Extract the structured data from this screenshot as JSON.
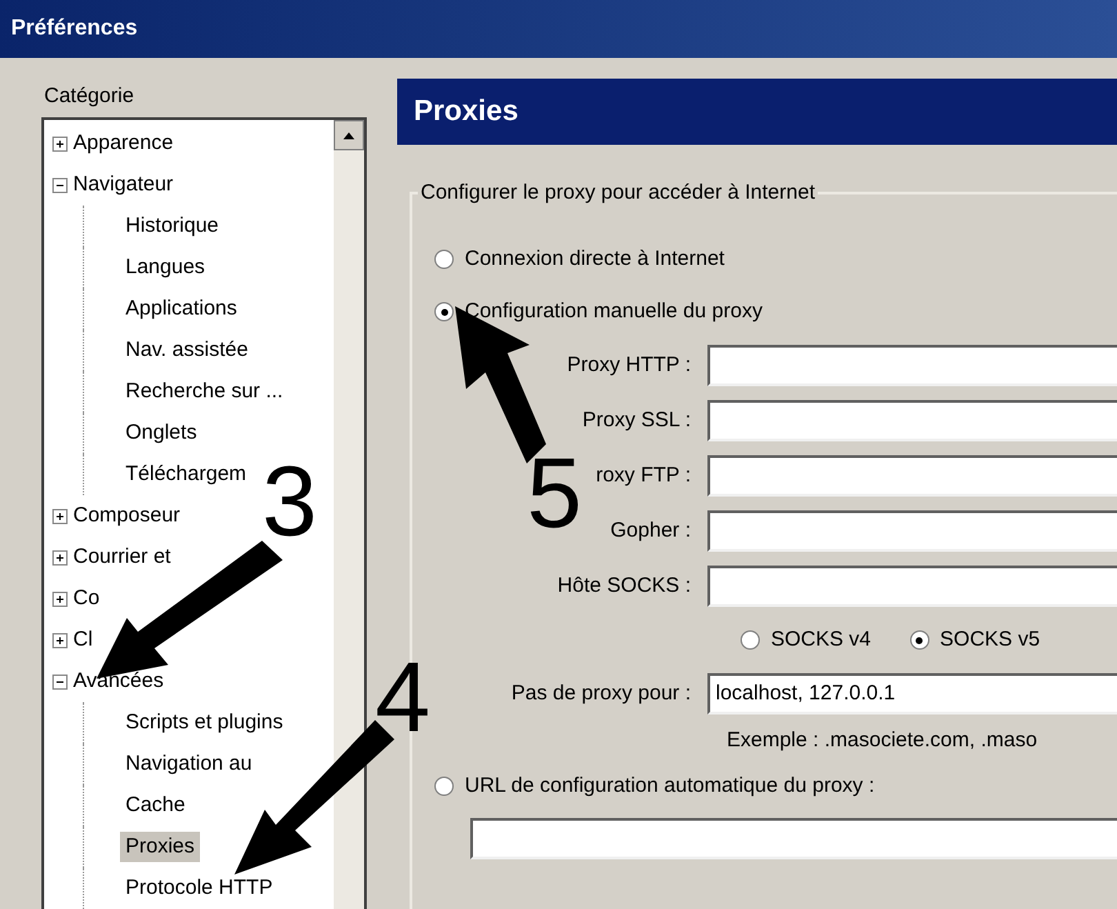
{
  "window": {
    "title": "Préférences"
  },
  "sidebar": {
    "label": "Catégorie",
    "items": [
      {
        "label": "Apparence",
        "expanded": false,
        "selected": false
      },
      {
        "label": "Navigateur",
        "expanded": true,
        "selected": false,
        "children": [
          {
            "label": "Historique",
            "selected": false
          },
          {
            "label": "Langues",
            "selected": false
          },
          {
            "label": "Applications",
            "selected": false
          },
          {
            "label": "Nav. assistée",
            "selected": false
          },
          {
            "label": "Recherche sur ...",
            "selected": false
          },
          {
            "label": "Onglets",
            "selected": false
          },
          {
            "label": "Téléchargem",
            "selected": false
          }
        ]
      },
      {
        "label": "Composeur",
        "expanded": false,
        "selected": false
      },
      {
        "label": "Courrier et",
        "expanded": false,
        "selected": false
      },
      {
        "label": "Co",
        "expanded": false,
        "selected": false
      },
      {
        "label": "Cl",
        "expanded": false,
        "selected": false
      },
      {
        "label": "Avancées",
        "expanded": true,
        "selected": false,
        "children": [
          {
            "label": "Scripts et plugins",
            "selected": false
          },
          {
            "label": "Navigation au",
            "selected": false
          },
          {
            "label": "Cache",
            "selected": false
          },
          {
            "label": "Proxies",
            "selected": true
          },
          {
            "label": "Protocole HTTP",
            "selected": false
          }
        ]
      }
    ]
  },
  "panel": {
    "title": "Proxies",
    "group_label": "Configurer le proxy pour accéder à Internet",
    "connection_modes": [
      {
        "kind": "direct",
        "label": "Connexion directe à Internet",
        "selected": false
      },
      {
        "kind": "manual",
        "label": "Configuration manuelle du proxy",
        "selected": true,
        "fields": [
          {
            "label": "Proxy HTTP :"
          },
          {
            "label": "Proxy SSL :"
          },
          {
            "label": "roxy FTP :"
          },
          {
            "label": "Gopher :"
          },
          {
            "label": "Hôte SOCKS :"
          }
        ],
        "socks_versions": [
          {
            "label": "SOCKS v4",
            "selected": false
          },
          {
            "label": "SOCKS v5",
            "selected": true
          }
        ],
        "no_proxy": {
          "label": "Pas de proxy pour :",
          "value": "localhost, 127.0.0.1"
        },
        "example": "Exemple : .masociete.com, .maso"
      },
      {
        "kind": "auto_url",
        "label": "URL de configuration automatique du proxy :",
        "selected": false
      }
    ]
  },
  "annotations": [
    {
      "label": "3"
    },
    {
      "label": "4"
    },
    {
      "label": "5"
    }
  ]
}
